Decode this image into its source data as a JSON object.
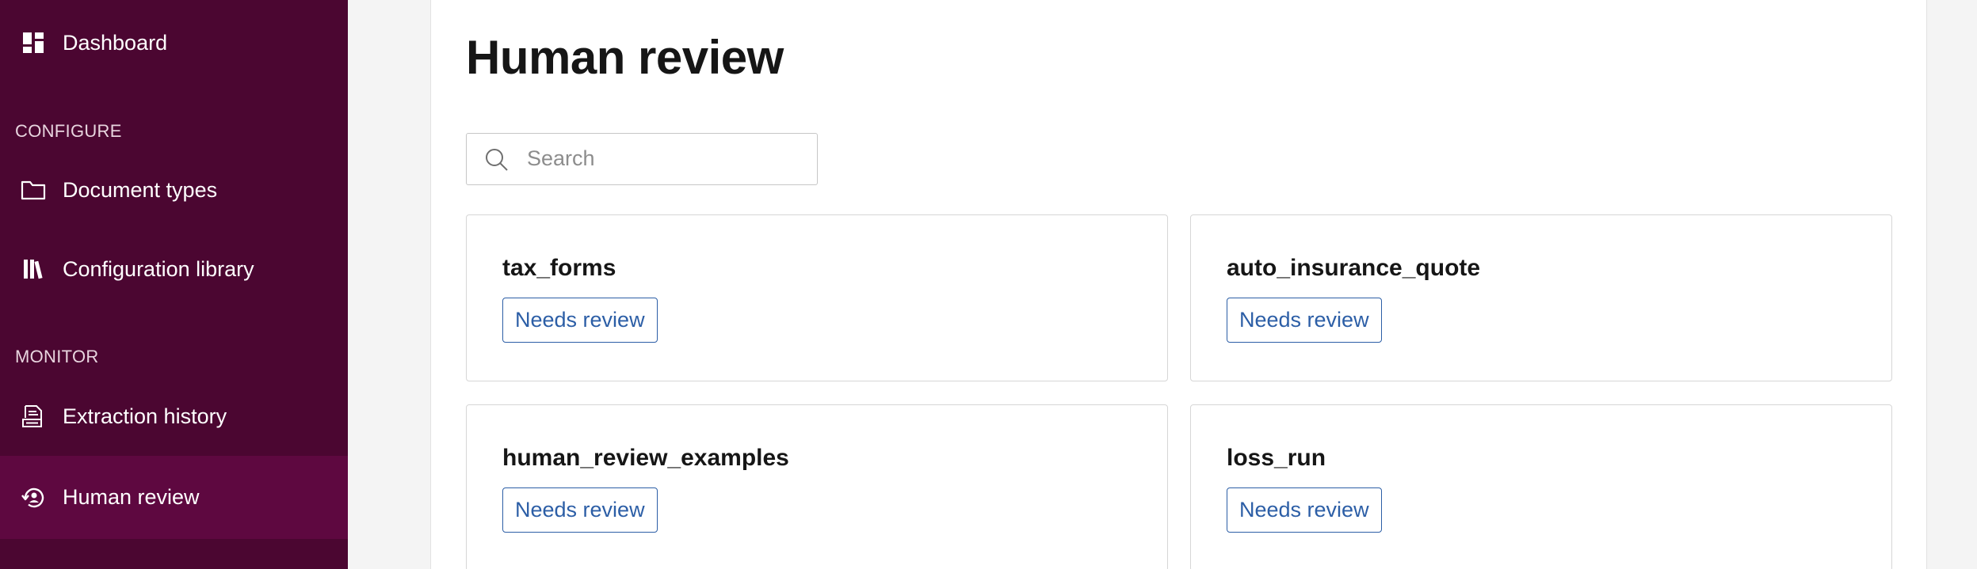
{
  "sidebar": {
    "dashboard": {
      "label": "Dashboard",
      "icon": "dashboard-icon"
    },
    "configure_section": "CONFIGURE",
    "document_types": {
      "label": "Document types",
      "icon": "folder-icon"
    },
    "configuration_library": {
      "label": "Configuration library",
      "icon": "library-icon"
    },
    "monitor_section": "MONITOR",
    "extraction_history": {
      "label": "Extraction history",
      "icon": "document-history-icon"
    },
    "human_review": {
      "label": "Human review",
      "icon": "review-history-icon",
      "active": true
    }
  },
  "main": {
    "title": "Human review",
    "search": {
      "placeholder": "Search",
      "value": ""
    },
    "cards": [
      {
        "title": "tax_forms",
        "status": "Needs review"
      },
      {
        "title": "auto_insurance_quote",
        "status": "Needs review"
      },
      {
        "title": "human_review_examples",
        "status": "Needs review"
      },
      {
        "title": "loss_run",
        "status": "Needs review"
      }
    ]
  },
  "colors": {
    "sidebar_bg": "#4b0631",
    "sidebar_active_bg": "#5e0840",
    "accent_link": "#2c5ea6",
    "page_bg": "#f4f4f4"
  }
}
